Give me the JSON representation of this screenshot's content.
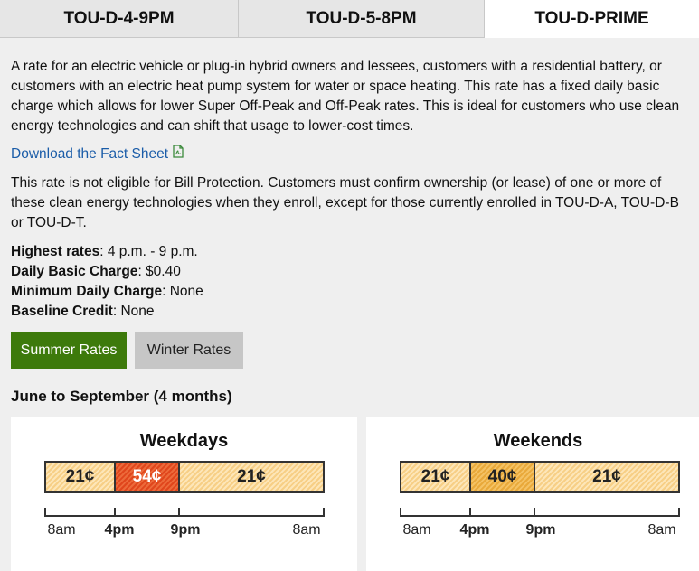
{
  "tabs": [
    "TOU-D-4-9PM",
    "TOU-D-5-8PM",
    "TOU-D-PRIME"
  ],
  "description": [
    "A rate for an electric vehicle or plug-in hybrid owners and lessees, customers with a residential battery, or",
    "customers with an electric heat pump system for water or space heating. This rate has a fixed daily basic",
    "charge which allows for lower Super Off-Peak and Off-Peak rates. This is ideal for customers who use clean",
    "energy technologies and can shift that usage to lower-cost times."
  ],
  "download_link": "Download the Fact Sheet",
  "eligibility": [
    "This rate is not eligible for Bill Protection. Customers must confirm ownership (or lease) of one or more of",
    "these clean energy technologies when they enroll, except for those currently enrolled in TOU-D-A, TOU-D-B",
    "or TOU-D-T."
  ],
  "facts": [
    {
      "label": "Highest rates",
      "value": ": 4 p.m. - 9 p.m."
    },
    {
      "label": "Daily Basic Charge",
      "value": ": $0.40"
    },
    {
      "label": "Minimum Daily Charge",
      "value": ": None"
    },
    {
      "label": "Baseline Credit",
      "value": ": None"
    }
  ],
  "buttons": {
    "summer": "Summer Rates",
    "winter": "Winter Rates"
  },
  "season_heading": "June to September (4 months)",
  "weekdays": {
    "title": "Weekdays",
    "segments": [
      "21¢",
      "54¢",
      "21¢"
    ],
    "labels": [
      "8am",
      "4pm",
      "9pm",
      "8am"
    ]
  },
  "weekends": {
    "title": "Weekends",
    "segments": [
      "21¢",
      "40¢",
      "21¢"
    ],
    "labels": [
      "8am",
      "4pm",
      "9pm",
      "8am"
    ]
  },
  "colors": {
    "summer_active": "#3d7a0b",
    "peak": "#e0461c",
    "mid_peak": "#e9a93a",
    "off_peak": "#f7cf86",
    "link": "#1a5ca8"
  },
  "icons": {
    "download": "pdf-file-icon"
  }
}
